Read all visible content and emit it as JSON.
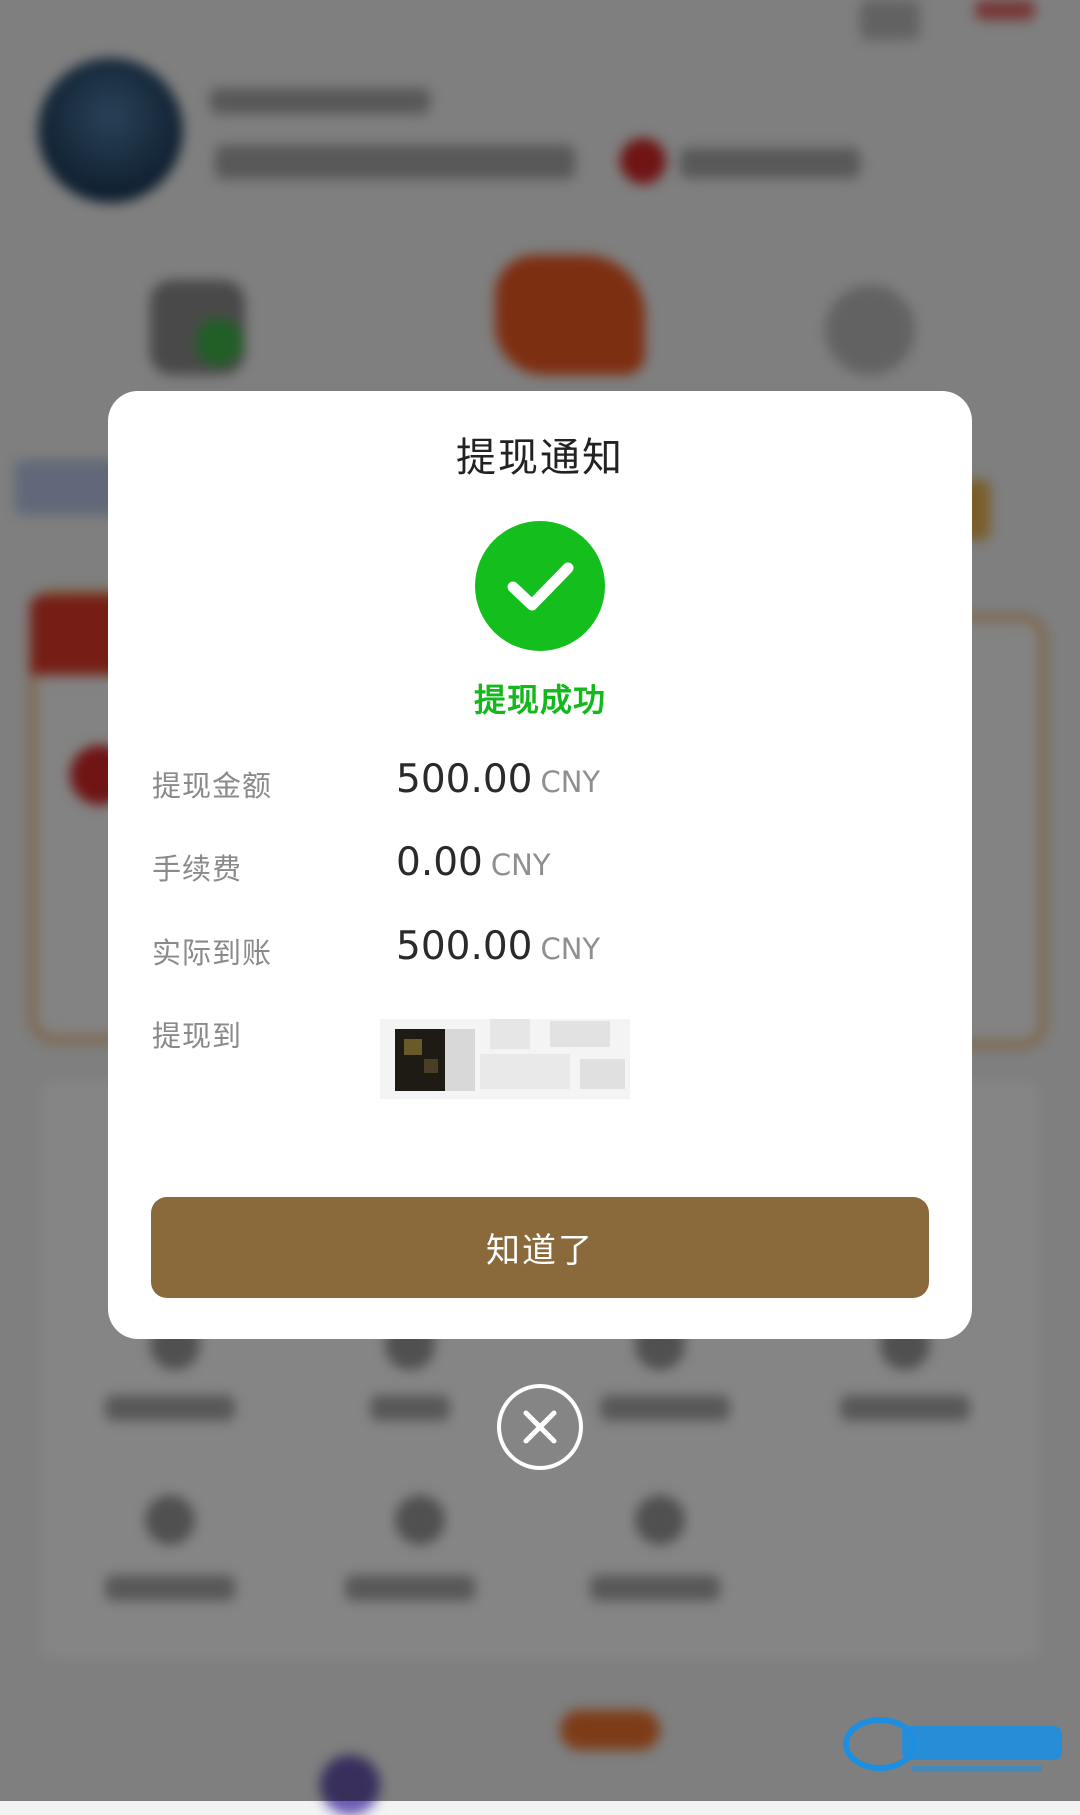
{
  "dialog": {
    "title": "提现通知",
    "status_text": "提现成功",
    "rows": [
      {
        "label": "提现金额",
        "amount": "500.00",
        "unit": "CNY"
      },
      {
        "label": "手续费",
        "amount": "0.00",
        "unit": "CNY"
      },
      {
        "label": "实际到账",
        "amount": "500.00",
        "unit": "CNY"
      },
      {
        "label": "提现到",
        "masked": true
      }
    ],
    "confirm_label": "知道了"
  },
  "icons": {
    "success": "check-circle-icon",
    "close": "close-circle-icon"
  },
  "colors": {
    "success_green": "#14bf1d",
    "button_brown": "#8a6a3b",
    "overlay": "rgba(0,0,0,0.48)"
  }
}
